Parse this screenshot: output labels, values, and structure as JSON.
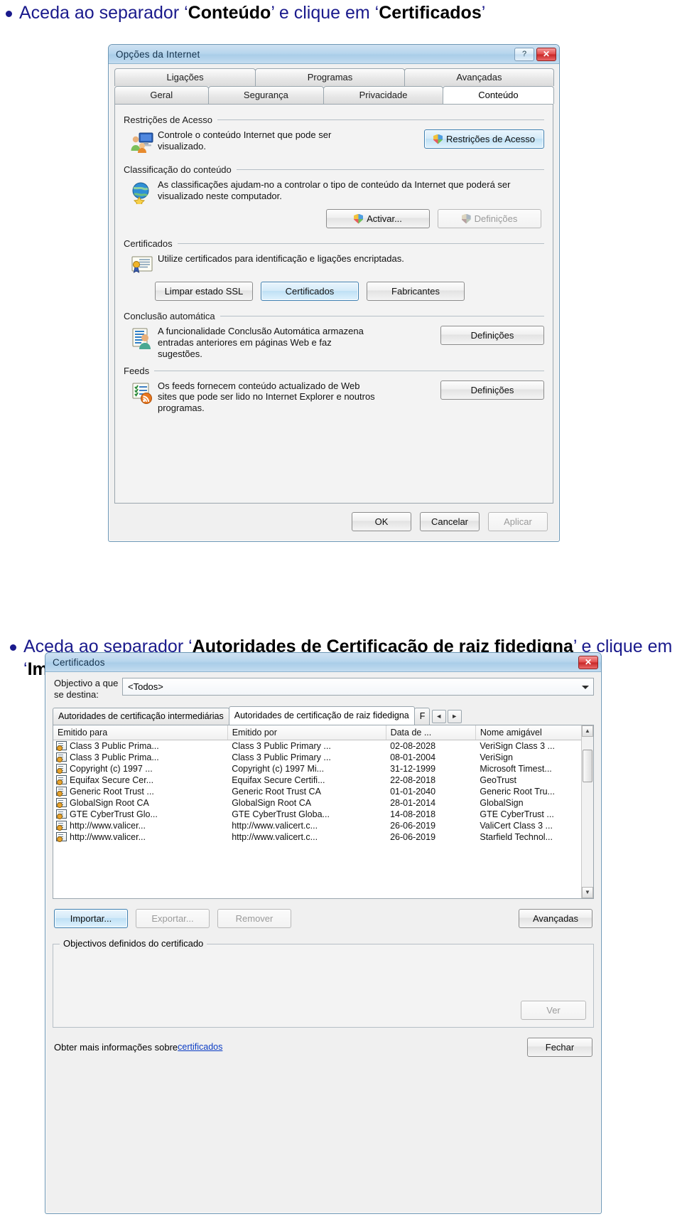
{
  "instructions": [
    {
      "prefix": "Aceda ao separador ‘",
      "bold1": "Conteúdo",
      "mid": "’ e clique em ‘",
      "bold2": "Certificados",
      "suffix": "’"
    },
    {
      "prefix": "Aceda ao separador ‘",
      "bold1": "Autoridades de Certificação de raiz fidedigna",
      "mid": "’ e clique em ‘",
      "bold2": "Importar",
      "suffix": "’"
    }
  ],
  "internet_options": {
    "title": "Opções da Internet",
    "titlebar_buttons": {
      "help": "?",
      "close": "✕"
    },
    "tabs_row1": [
      "Ligações",
      "Programas",
      "Avançadas"
    ],
    "tabs_row2": [
      "Geral",
      "Segurança",
      "Privacidade",
      "Conteúdo"
    ],
    "active_tab": "Conteúdo",
    "groups": [
      {
        "caption": "Restrições de Acesso",
        "icon": "parental-controls-icon",
        "description": "Controle o conteúdo Internet que pode ser visualizado.",
        "buttons": [
          {
            "label": "Restrições de Acesso",
            "shield": true,
            "state": "highlight"
          }
        ]
      },
      {
        "caption": "Classificação do conteúdo",
        "icon": "content-advisor-globe-icon",
        "description": "As classificações ajudam-no a controlar o tipo de conteúdo da Internet que poderá ser visualizado neste computador.",
        "buttons": [
          {
            "label": "Activar...",
            "shield": true,
            "state": "normal"
          },
          {
            "label": "Definições",
            "shield": true,
            "state": "disabled"
          }
        ]
      },
      {
        "caption": "Certificados",
        "icon": "certificate-icon",
        "description": "Utilize certificados para identificação e ligações encriptadas.",
        "buttons": [
          {
            "label": "Limpar estado SSL",
            "shield": false,
            "state": "normal"
          },
          {
            "label": "Certificados",
            "shield": false,
            "state": "highlight"
          },
          {
            "label": "Fabricantes",
            "shield": false,
            "state": "normal"
          }
        ]
      },
      {
        "caption": "Conclusão automática",
        "icon": "autocomplete-icon",
        "description": "A funcionalidade Conclusão Automática armazena entradas anteriores em páginas Web e faz sugestões.",
        "buttons": [
          {
            "label": "Definições",
            "shield": false,
            "state": "normal"
          }
        ]
      },
      {
        "caption": "Feeds",
        "icon": "feeds-rss-icon",
        "description": "Os feeds fornecem conteúdo actualizado de Web sites que pode ser lido no Internet Explorer e noutros programas.",
        "buttons": [
          {
            "label": "Definições",
            "shield": false,
            "state": "normal"
          }
        ]
      }
    ],
    "footer_buttons": [
      {
        "label": "OK",
        "state": "normal"
      },
      {
        "label": "Cancelar",
        "state": "normal"
      },
      {
        "label": "Aplicar",
        "state": "disabled"
      }
    ]
  },
  "certificates_dialog": {
    "title": "Certificados",
    "titlebar_buttons": {
      "close": "✕"
    },
    "purpose_field": {
      "label": "Objectivo a que se destina:",
      "value": "<Todos>"
    },
    "tabs": [
      "Autoridades de certificação intermediárias",
      "Autoridades de certificação de raiz fidedigna",
      "F"
    ],
    "active_tab": "Autoridades de certificação de raiz fidedigna",
    "tab_scroll": {
      "left": "◄",
      "right": "►"
    },
    "columns": [
      "Emitido para",
      "Emitido por",
      "Data de ...",
      "Nome amigável"
    ],
    "rows": [
      [
        "Class 3 Public Prima...",
        "Class 3 Public Primary ...",
        "02-08-2028",
        "VeriSign Class 3 ..."
      ],
      [
        "Class 3 Public Prima...",
        "Class 3 Public Primary ...",
        "08-01-2004",
        "VeriSign"
      ],
      [
        "Copyright (c) 1997 ...",
        "Copyright (c) 1997 Mi...",
        "31-12-1999",
        "Microsoft Timest..."
      ],
      [
        "Equifax Secure Cer...",
        "Equifax Secure Certifi...",
        "22-08-2018",
        "GeoTrust"
      ],
      [
        "Generic Root Trust ...",
        "Generic Root Trust CA",
        "01-01-2040",
        "Generic Root Tru..."
      ],
      [
        "GlobalSign Root CA",
        "GlobalSign Root CA",
        "28-01-2014",
        "GlobalSign"
      ],
      [
        "GTE CyberTrust Glo...",
        "GTE CyberTrust Globa...",
        "14-08-2018",
        "GTE CyberTrust ..."
      ],
      [
        "http://www.valicer...",
        "http://www.valicert.c...",
        "26-06-2019",
        "ValiCert Class 3 ..."
      ],
      [
        "http://www.valicer...",
        "http://www.valicert.c...",
        "26-06-2019",
        "Starfield Technol..."
      ]
    ],
    "action_buttons": [
      {
        "label": "Importar...",
        "state": "highlight"
      },
      {
        "label": "Exportar...",
        "state": "disabled"
      },
      {
        "label": "Remover",
        "state": "disabled"
      }
    ],
    "advanced_button": {
      "label": "Avançadas",
      "state": "normal"
    },
    "purpose_group": {
      "caption": "Objectivos definidos do certificado",
      "view_button": {
        "label": "Ver",
        "state": "disabled"
      }
    },
    "learn_more": {
      "text": "Obter mais informações sobre ",
      "link": "certificados"
    },
    "close_button": {
      "label": "Fechar",
      "state": "normal"
    }
  }
}
